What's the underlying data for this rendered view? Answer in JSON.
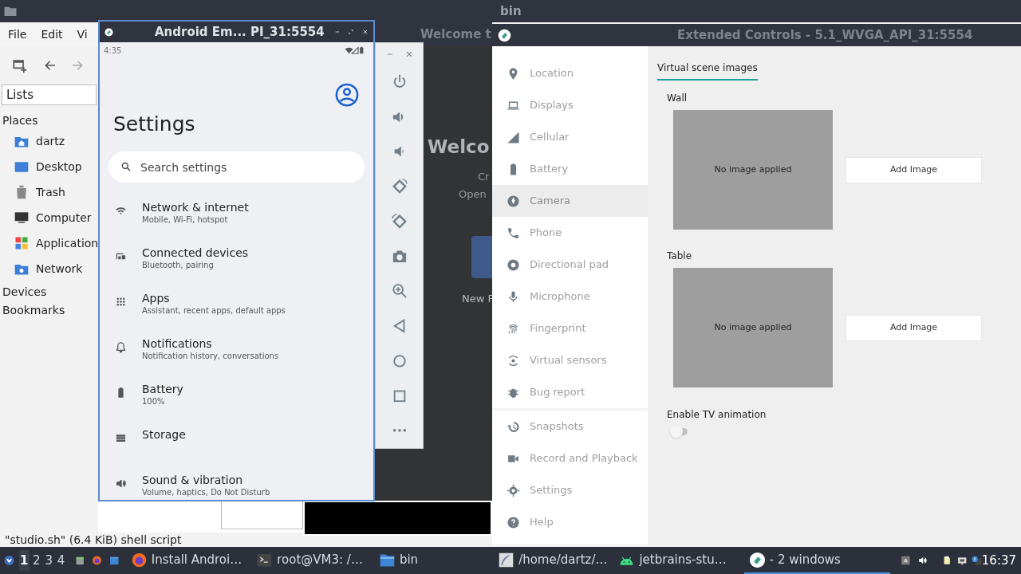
{
  "file_manager": {
    "title": "bin",
    "menu": [
      "File",
      "Edit",
      "Vi"
    ],
    "location": "Lists",
    "sections": [
      {
        "label": "Places",
        "items": [
          "dartz",
          "Desktop",
          "Trash",
          "Computer",
          "Application",
          "Network"
        ]
      },
      {
        "label": "Devices"
      },
      {
        "label": "Bookmarks"
      }
    ],
    "status": "\"studio.sh\" (6.4 KiB) shell script"
  },
  "welcome": {
    "title": "Welcome t",
    "heading": "Welco",
    "lines": [
      "Cr",
      "Open"
    ],
    "action": "New F"
  },
  "emulator": {
    "title": "Android Em... PI_31:5554",
    "time": "4:35",
    "heading": "Settings",
    "search": {
      "placeholder": "Search settings"
    },
    "items": [
      {
        "title": "Network & internet",
        "subtitle": "Mobile, Wi-Fi, hotspot"
      },
      {
        "title": "Connected devices",
        "subtitle": "Bluetooth, pairing"
      },
      {
        "title": "Apps",
        "subtitle": "Assistant, recent apps, default apps"
      },
      {
        "title": "Notifications",
        "subtitle": "Notification history, conversations"
      },
      {
        "title": "Battery",
        "subtitle": "100%"
      },
      {
        "title": "Storage"
      },
      {
        "title": "Sound & vibration",
        "subtitle": "Volume, haptics, Do Not Disturb"
      }
    ]
  },
  "extended_controls": {
    "title": "Extended Controls - 5.1_WVGA_API_31:5554",
    "nav_groups": [
      [
        {
          "label": "Location",
          "selected": false
        },
        {
          "label": "Displays",
          "selected": false
        },
        {
          "label": "Cellular",
          "selected": false
        },
        {
          "label": "Battery",
          "selected": false
        },
        {
          "label": "Camera",
          "selected": true
        },
        {
          "label": "Phone",
          "selected": false
        },
        {
          "label": "Directional pad",
          "selected": false
        },
        {
          "label": "Microphone",
          "selected": false
        },
        {
          "label": "Fingerprint",
          "selected": false
        },
        {
          "label": "Virtual sensors",
          "selected": false
        },
        {
          "label": "Bug report",
          "selected": false
        }
      ],
      [
        {
          "label": "Snapshots",
          "selected": false
        },
        {
          "label": "Record and Playback",
          "selected": false
        },
        {
          "label": "Settings",
          "selected": false
        },
        {
          "label": "Help",
          "selected": false
        }
      ]
    ],
    "tabs": [
      {
        "label": "Virtual scene images",
        "selected": true
      }
    ],
    "scenes": [
      {
        "label": "Wall",
        "image_status": "No image applied",
        "button": "Add Image"
      },
      {
        "label": "Table",
        "image_status": "No image applied",
        "button": "Add Image"
      }
    ],
    "toggle": {
      "label": "Enable TV animation",
      "on": false
    }
  },
  "taskbar": {
    "workspaces": [
      {
        "label": "1",
        "selected": true
      },
      {
        "label": "2",
        "selected": false
      },
      {
        "label": "3",
        "selected": false
      },
      {
        "label": "4",
        "selected": false
      }
    ],
    "tasks": [
      {
        "label": "Install Androi…",
        "selected": false
      },
      {
        "label": "root@VM3: /…",
        "selected": false
      },
      {
        "label": "bin",
        "selected": false
      },
      {
        "label": "/home/dartz/…",
        "selected": false
      },
      {
        "label": "jetbrains-stu…",
        "selected": false
      },
      {
        "label": "- 2 windows",
        "selected": true
      }
    ],
    "clock": "16:37"
  }
}
